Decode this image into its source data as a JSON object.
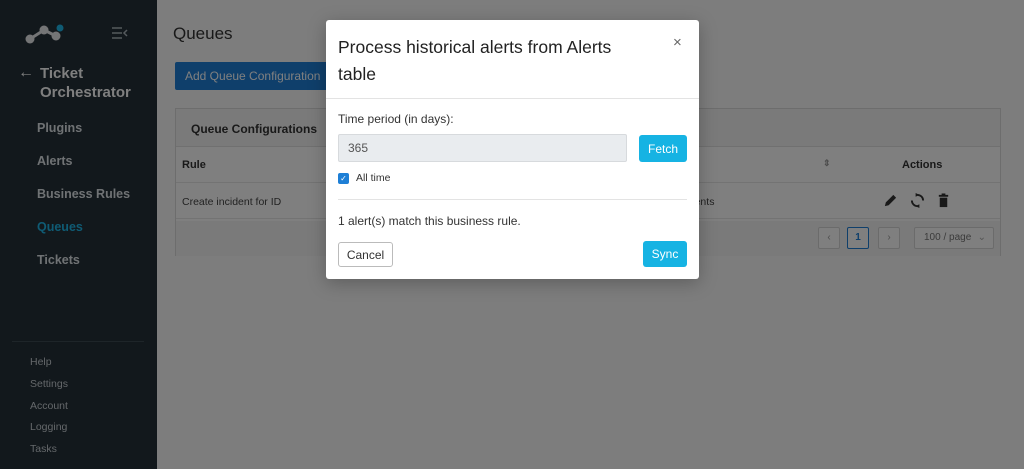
{
  "sidebar": {
    "app_title": "Ticket Orchestrator",
    "nav": [
      "Plugins",
      "Alerts",
      "Business Rules",
      "Queues",
      "Tickets"
    ],
    "active_nav": "Queues",
    "footer": [
      "Help",
      "Settings",
      "Account",
      "Logging",
      "Tasks"
    ],
    "colors": {
      "background": "#243038",
      "active": "#1fb6e8"
    }
  },
  "main": {
    "page_title": "Queues",
    "add_button": "Add Queue Configuration",
    "card_title": "Queue Configurations",
    "table": {
      "headers": {
        "rule": "Rule",
        "actions": "Actions"
      },
      "rows": [
        {
          "rule": "Create incident for ID",
          "incidents": "incidents"
        }
      ]
    },
    "pagination": {
      "current_page": "1",
      "page_size": "100 / page"
    }
  },
  "modal": {
    "title": "Process historical alerts from Alerts table",
    "close_symbol": "×",
    "period_label": "Time period (in days):",
    "period_value": "365",
    "fetch_button": "Fetch",
    "all_time_label": "All time",
    "all_time_checked": true,
    "match_text": "1 alert(s) match this business rule.",
    "cancel_button": "Cancel",
    "sync_button": "Sync",
    "colors": {
      "primary": "#16b3e3",
      "checkbox": "#1e7fd6"
    }
  }
}
